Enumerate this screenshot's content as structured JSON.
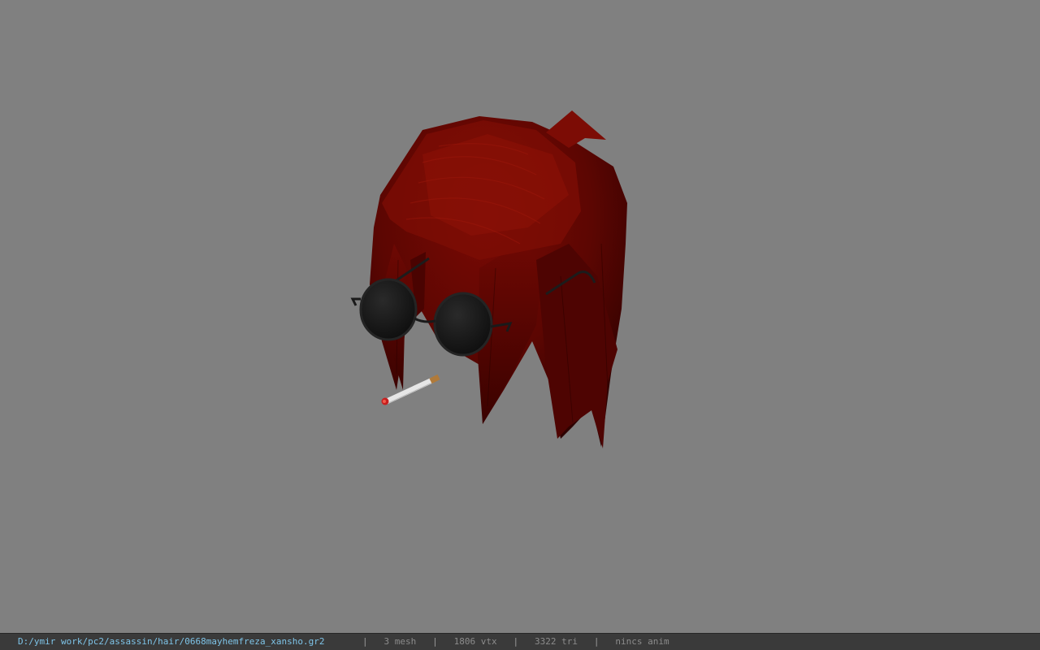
{
  "viewport": {
    "background_color": "#808080",
    "model": "hair mesh with round sunglasses and cigarette",
    "hair_color": "#8a0c06",
    "lens_color": "#181818"
  },
  "statusbar": {
    "file_path": "D:/ymir work/pc2/assassin/hair/0668mayhemfreza_xansho.gr2",
    "separator": "|",
    "mesh_count": "3 mesh",
    "vertex_count": "1806 vtx",
    "triangle_count": "3322 tri",
    "anim_status": "nincs anim",
    "path_color": "#7ec4e8",
    "text_color": "#8c8c8c"
  }
}
